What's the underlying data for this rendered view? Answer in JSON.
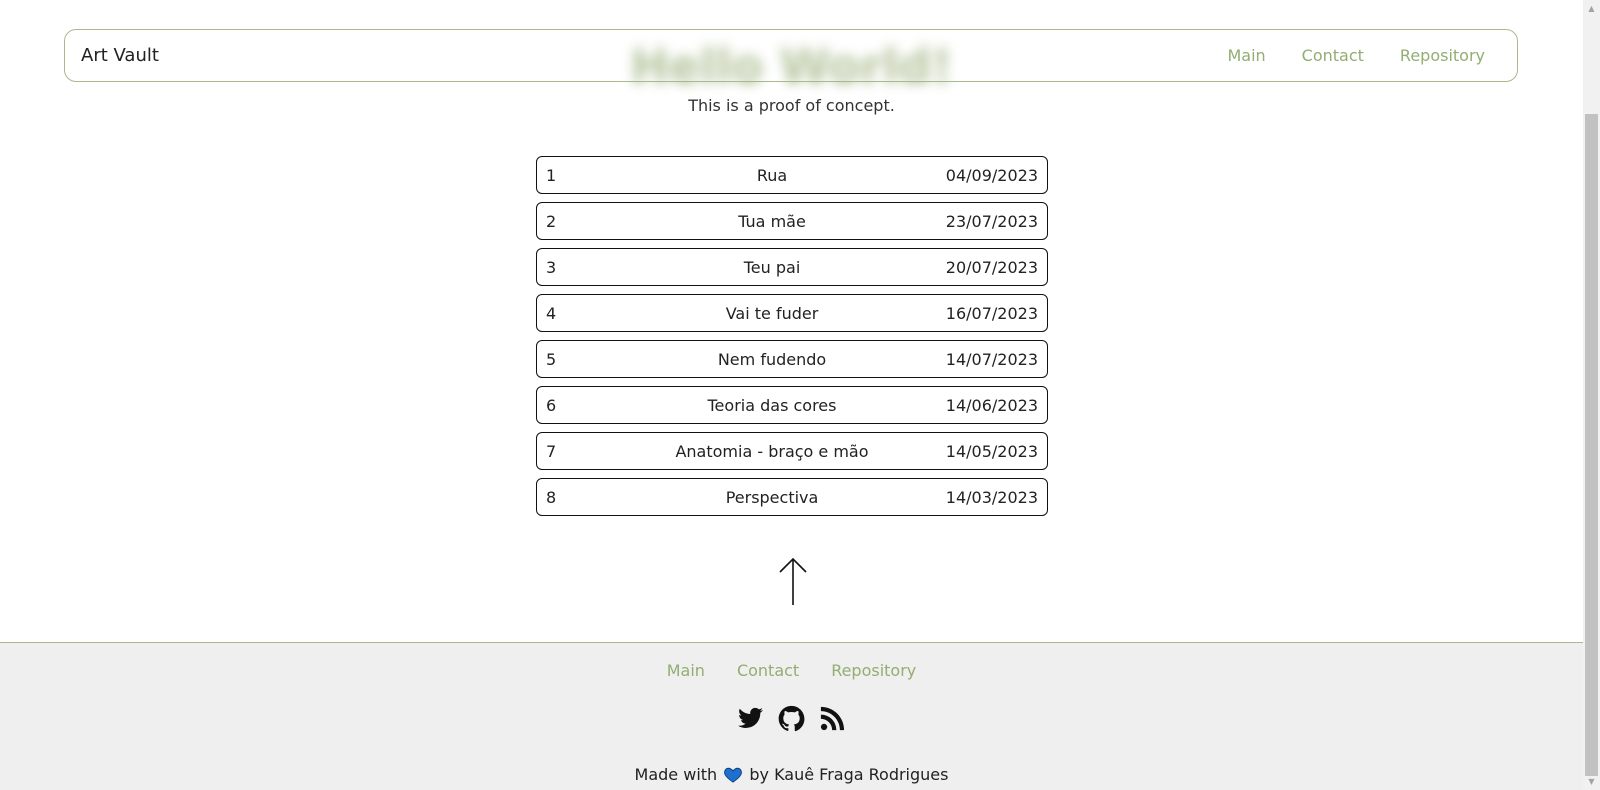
{
  "header": {
    "brand": "Art Vault",
    "nav": [
      {
        "label": "Main"
      },
      {
        "label": "Contact"
      },
      {
        "label": "Repository"
      }
    ]
  },
  "hero": {
    "title": "Hello World!",
    "subtitle": "This is a proof of concept."
  },
  "entries": [
    {
      "number": "1",
      "title": "Rua",
      "date": "04/09/2023"
    },
    {
      "number": "2",
      "title": "Tua mãe",
      "date": "23/07/2023"
    },
    {
      "number": "3",
      "title": "Teu pai",
      "date": "20/07/2023"
    },
    {
      "number": "4",
      "title": "Vai te fuder",
      "date": "16/07/2023"
    },
    {
      "number": "5",
      "title": "Nem fudendo",
      "date": "14/07/2023"
    },
    {
      "number": "6",
      "title": "Teoria das cores",
      "date": "14/06/2023"
    },
    {
      "number": "7",
      "title": "Anatomia - braço e mão",
      "date": "14/05/2023"
    },
    {
      "number": "8",
      "title": "Perspectiva",
      "date": "14/03/2023"
    }
  ],
  "footer": {
    "links": [
      {
        "label": "Main"
      },
      {
        "label": "Contact"
      },
      {
        "label": "Repository"
      }
    ],
    "social_icons": [
      "twitter-icon",
      "github-icon",
      "rss-icon"
    ],
    "credit_prefix": "Made with",
    "credit_suffix": "by Kauê Fraga Rodrigues"
  },
  "colors": {
    "accent": "#93ad72",
    "border": "#a9b88e",
    "heart": "#1e6fd0",
    "footer_bg": "#efefef"
  }
}
